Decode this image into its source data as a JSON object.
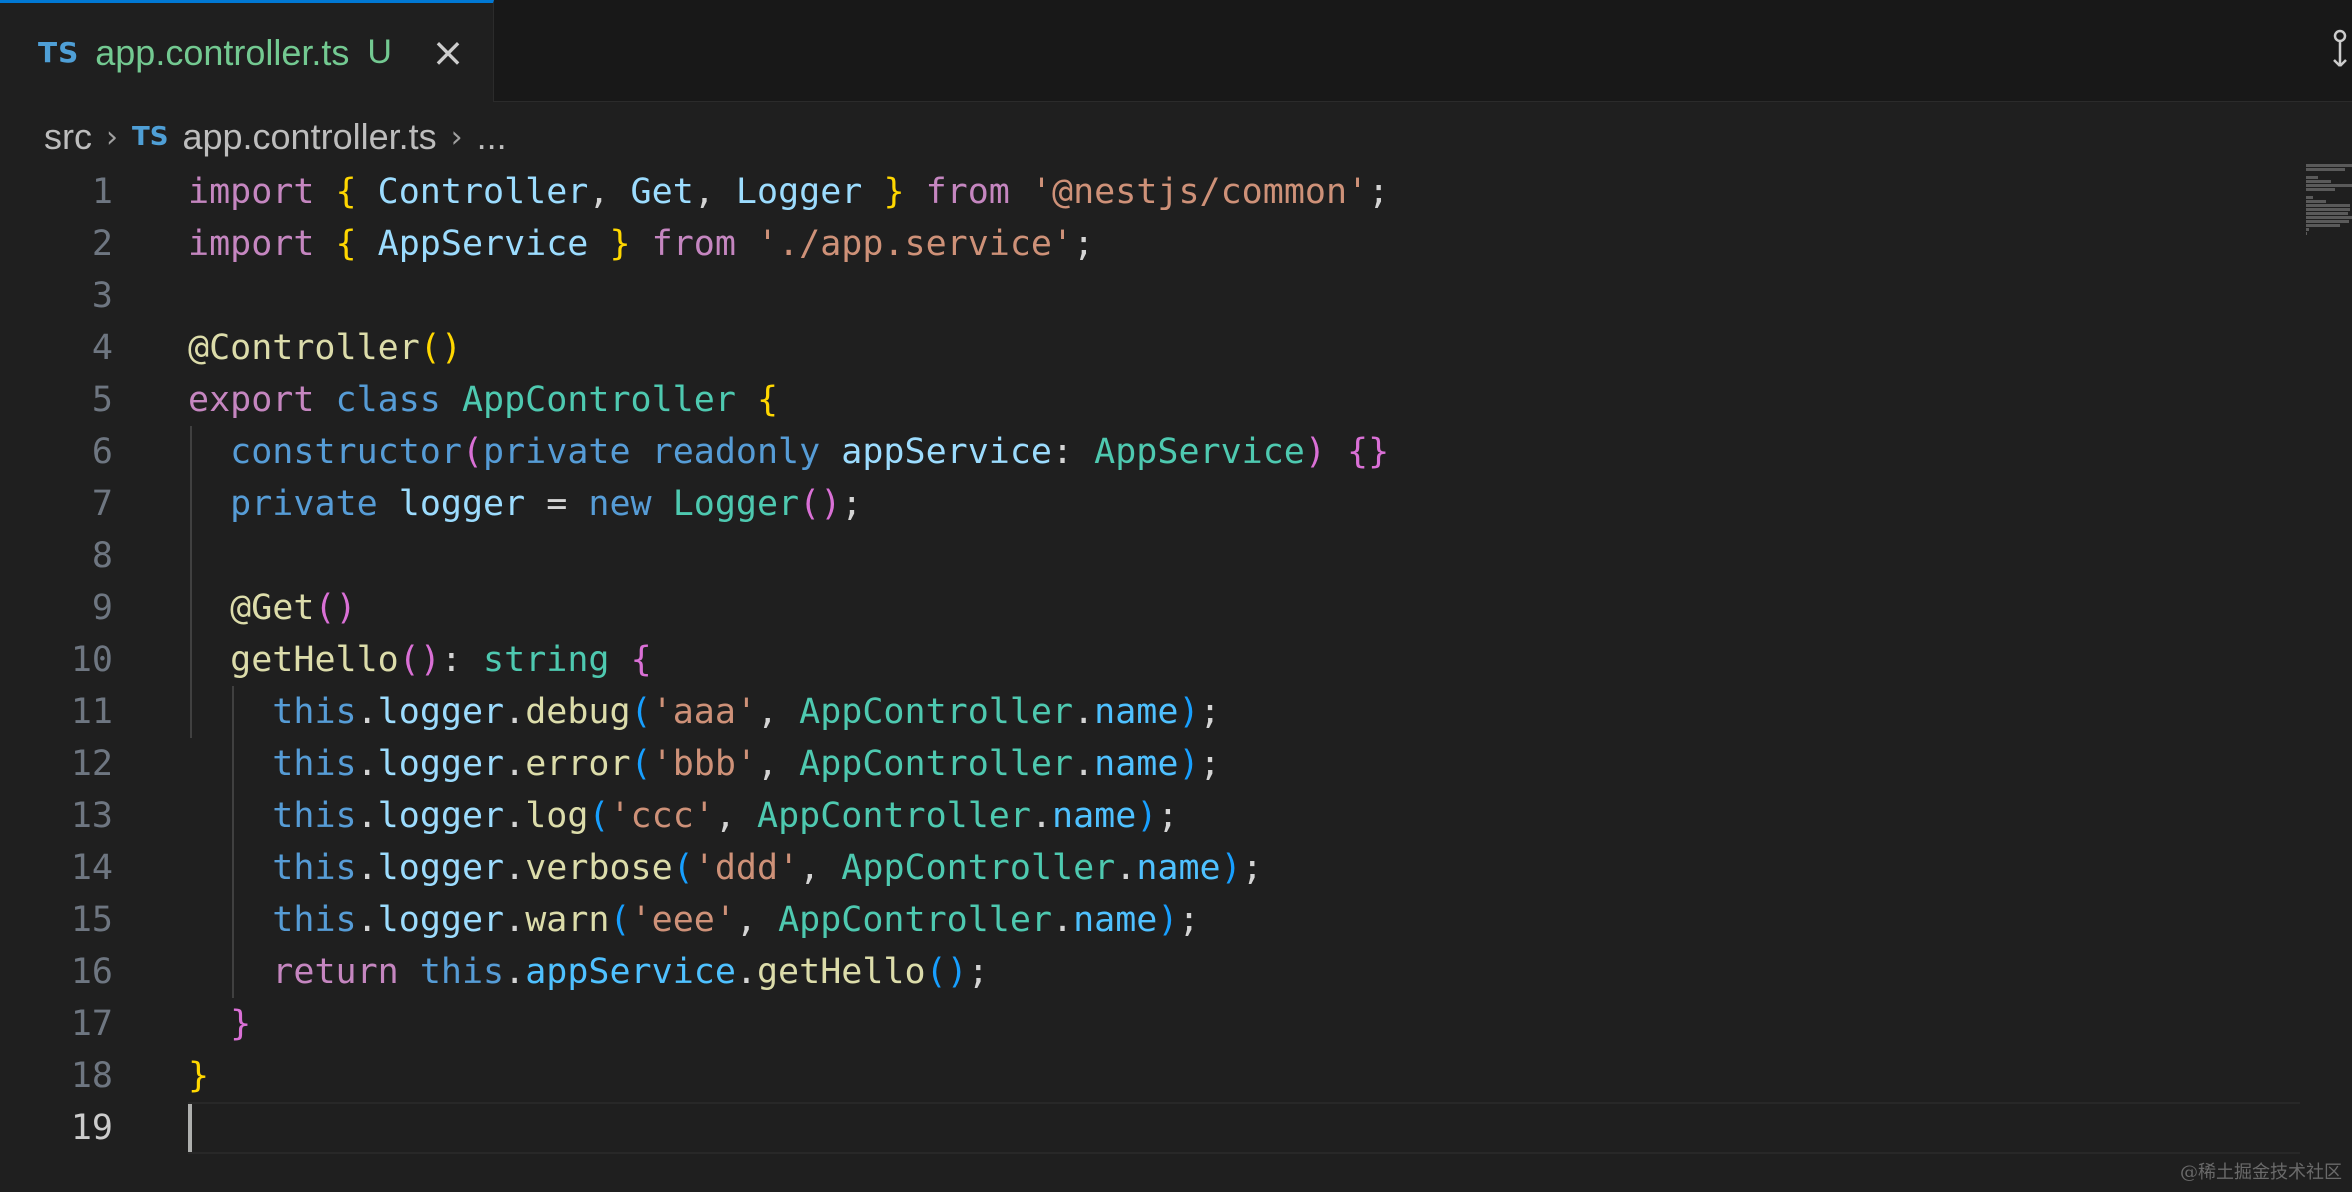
{
  "tab": {
    "icon": "TS",
    "filename": "app.controller.ts",
    "status": "U",
    "close_icon": "×"
  },
  "breadcrumb": {
    "folder": "src",
    "file_icon": "TS",
    "file": "app.controller.ts",
    "more": "..."
  },
  "editor": {
    "active_line": 19,
    "lines": [
      {
        "n": "1",
        "tokens": [
          {
            "t": "import",
            "c": "kw"
          },
          {
            "t": " ",
            "c": "pl"
          },
          {
            "t": "{",
            "c": "br1"
          },
          {
            "t": " Controller",
            "c": "id"
          },
          {
            "t": ", ",
            "c": "pl"
          },
          {
            "t": "Get",
            "c": "id"
          },
          {
            "t": ", ",
            "c": "pl"
          },
          {
            "t": "Logger",
            "c": "id"
          },
          {
            "t": " ",
            "c": "pl"
          },
          {
            "t": "}",
            "c": "br1"
          },
          {
            "t": " ",
            "c": "pl"
          },
          {
            "t": "from",
            "c": "kw"
          },
          {
            "t": " ",
            "c": "pl"
          },
          {
            "t": "'@nestjs/common'",
            "c": "str"
          },
          {
            "t": ";",
            "c": "pl"
          }
        ]
      },
      {
        "n": "2",
        "tokens": [
          {
            "t": "import",
            "c": "kw"
          },
          {
            "t": " ",
            "c": "pl"
          },
          {
            "t": "{",
            "c": "br1"
          },
          {
            "t": " AppService",
            "c": "id"
          },
          {
            "t": " ",
            "c": "pl"
          },
          {
            "t": "}",
            "c": "br1"
          },
          {
            "t": " ",
            "c": "pl"
          },
          {
            "t": "from",
            "c": "kw"
          },
          {
            "t": " ",
            "c": "pl"
          },
          {
            "t": "'./app.service'",
            "c": "str"
          },
          {
            "t": ";",
            "c": "pl"
          }
        ]
      },
      {
        "n": "3",
        "tokens": []
      },
      {
        "n": "4",
        "tokens": [
          {
            "t": "@Controller",
            "c": "fn"
          },
          {
            "t": "()",
            "c": "br1"
          }
        ]
      },
      {
        "n": "5",
        "tokens": [
          {
            "t": "export",
            "c": "kw"
          },
          {
            "t": " ",
            "c": "pl"
          },
          {
            "t": "class",
            "c": "kb"
          },
          {
            "t": " ",
            "c": "pl"
          },
          {
            "t": "AppController",
            "c": "cls"
          },
          {
            "t": " ",
            "c": "pl"
          },
          {
            "t": "{",
            "c": "br1"
          }
        ]
      },
      {
        "n": "6",
        "tokens": [
          {
            "t": "  ",
            "c": "pl"
          },
          {
            "t": "constructor",
            "c": "kb"
          },
          {
            "t": "(",
            "c": "br2"
          },
          {
            "t": "private",
            "c": "kb"
          },
          {
            "t": " ",
            "c": "pl"
          },
          {
            "t": "readonly",
            "c": "kb"
          },
          {
            "t": " ",
            "c": "pl"
          },
          {
            "t": "appService",
            "c": "id"
          },
          {
            "t": ": ",
            "c": "pl"
          },
          {
            "t": "AppService",
            "c": "cls"
          },
          {
            "t": ")",
            "c": "br2"
          },
          {
            "t": " ",
            "c": "pl"
          },
          {
            "t": "{}",
            "c": "br2"
          }
        ]
      },
      {
        "n": "7",
        "tokens": [
          {
            "t": "  ",
            "c": "pl"
          },
          {
            "t": "private",
            "c": "kb"
          },
          {
            "t": " ",
            "c": "pl"
          },
          {
            "t": "logger",
            "c": "id"
          },
          {
            "t": " = ",
            "c": "pl"
          },
          {
            "t": "new",
            "c": "kb"
          },
          {
            "t": " ",
            "c": "pl"
          },
          {
            "t": "Logger",
            "c": "cls"
          },
          {
            "t": "()",
            "c": "br2"
          },
          {
            "t": ";",
            "c": "pl"
          }
        ]
      },
      {
        "n": "8",
        "tokens": []
      },
      {
        "n": "9",
        "tokens": [
          {
            "t": "  ",
            "c": "pl"
          },
          {
            "t": "@Get",
            "c": "fn"
          },
          {
            "t": "()",
            "c": "br2"
          }
        ]
      },
      {
        "n": "10",
        "tokens": [
          {
            "t": "  ",
            "c": "pl"
          },
          {
            "t": "getHello",
            "c": "fn"
          },
          {
            "t": "()",
            "c": "br2"
          },
          {
            "t": ": ",
            "c": "pl"
          },
          {
            "t": "string",
            "c": "cls"
          },
          {
            "t": " ",
            "c": "pl"
          },
          {
            "t": "{",
            "c": "br2"
          }
        ]
      },
      {
        "n": "11",
        "tokens": [
          {
            "t": "    ",
            "c": "pl"
          },
          {
            "t": "this",
            "c": "kb"
          },
          {
            "t": ".",
            "c": "pl"
          },
          {
            "t": "logger",
            "c": "id"
          },
          {
            "t": ".",
            "c": "pl"
          },
          {
            "t": "debug",
            "c": "fn"
          },
          {
            "t": "(",
            "c": "br3"
          },
          {
            "t": "'aaa'",
            "c": "str"
          },
          {
            "t": ", ",
            "c": "pl"
          },
          {
            "t": "AppController",
            "c": "cls"
          },
          {
            "t": ".",
            "c": "pl"
          },
          {
            "t": "name",
            "c": "prop"
          },
          {
            "t": ")",
            "c": "br3"
          },
          {
            "t": ";",
            "c": "pl"
          }
        ]
      },
      {
        "n": "12",
        "tokens": [
          {
            "t": "    ",
            "c": "pl"
          },
          {
            "t": "this",
            "c": "kb"
          },
          {
            "t": ".",
            "c": "pl"
          },
          {
            "t": "logger",
            "c": "id"
          },
          {
            "t": ".",
            "c": "pl"
          },
          {
            "t": "error",
            "c": "fn"
          },
          {
            "t": "(",
            "c": "br3"
          },
          {
            "t": "'bbb'",
            "c": "str"
          },
          {
            "t": ", ",
            "c": "pl"
          },
          {
            "t": "AppController",
            "c": "cls"
          },
          {
            "t": ".",
            "c": "pl"
          },
          {
            "t": "name",
            "c": "prop"
          },
          {
            "t": ")",
            "c": "br3"
          },
          {
            "t": ";",
            "c": "pl"
          }
        ]
      },
      {
        "n": "13",
        "tokens": [
          {
            "t": "    ",
            "c": "pl"
          },
          {
            "t": "this",
            "c": "kb"
          },
          {
            "t": ".",
            "c": "pl"
          },
          {
            "t": "logger",
            "c": "id"
          },
          {
            "t": ".",
            "c": "pl"
          },
          {
            "t": "log",
            "c": "fn"
          },
          {
            "t": "(",
            "c": "br3"
          },
          {
            "t": "'ccc'",
            "c": "str"
          },
          {
            "t": ", ",
            "c": "pl"
          },
          {
            "t": "AppController",
            "c": "cls"
          },
          {
            "t": ".",
            "c": "pl"
          },
          {
            "t": "name",
            "c": "prop"
          },
          {
            "t": ")",
            "c": "br3"
          },
          {
            "t": ";",
            "c": "pl"
          }
        ]
      },
      {
        "n": "14",
        "tokens": [
          {
            "t": "    ",
            "c": "pl"
          },
          {
            "t": "this",
            "c": "kb"
          },
          {
            "t": ".",
            "c": "pl"
          },
          {
            "t": "logger",
            "c": "id"
          },
          {
            "t": ".",
            "c": "pl"
          },
          {
            "t": "verbose",
            "c": "fn"
          },
          {
            "t": "(",
            "c": "br3"
          },
          {
            "t": "'ddd'",
            "c": "str"
          },
          {
            "t": ", ",
            "c": "pl"
          },
          {
            "t": "AppController",
            "c": "cls"
          },
          {
            "t": ".",
            "c": "pl"
          },
          {
            "t": "name",
            "c": "prop"
          },
          {
            "t": ")",
            "c": "br3"
          },
          {
            "t": ";",
            "c": "pl"
          }
        ]
      },
      {
        "n": "15",
        "tokens": [
          {
            "t": "    ",
            "c": "pl"
          },
          {
            "t": "this",
            "c": "kb"
          },
          {
            "t": ".",
            "c": "pl"
          },
          {
            "t": "logger",
            "c": "id"
          },
          {
            "t": ".",
            "c": "pl"
          },
          {
            "t": "warn",
            "c": "fn"
          },
          {
            "t": "(",
            "c": "br3"
          },
          {
            "t": "'eee'",
            "c": "str"
          },
          {
            "t": ", ",
            "c": "pl"
          },
          {
            "t": "AppController",
            "c": "cls"
          },
          {
            "t": ".",
            "c": "pl"
          },
          {
            "t": "name",
            "c": "prop"
          },
          {
            "t": ")",
            "c": "br3"
          },
          {
            "t": ";",
            "c": "pl"
          }
        ]
      },
      {
        "n": "16",
        "tokens": [
          {
            "t": "    ",
            "c": "pl"
          },
          {
            "t": "return",
            "c": "kw"
          },
          {
            "t": " ",
            "c": "pl"
          },
          {
            "t": "this",
            "c": "kb"
          },
          {
            "t": ".",
            "c": "pl"
          },
          {
            "t": "appService",
            "c": "prop"
          },
          {
            "t": ".",
            "c": "pl"
          },
          {
            "t": "getHello",
            "c": "fn"
          },
          {
            "t": "()",
            "c": "br3"
          },
          {
            "t": ";",
            "c": "pl"
          }
        ]
      },
      {
        "n": "17",
        "tokens": [
          {
            "t": "  ",
            "c": "pl"
          },
          {
            "t": "}",
            "c": "br2"
          }
        ]
      },
      {
        "n": "18",
        "tokens": [
          {
            "t": "}",
            "c": "br1"
          }
        ]
      },
      {
        "n": "19",
        "tokens": []
      }
    ]
  },
  "watermark": "@稀土掘金技术社区"
}
